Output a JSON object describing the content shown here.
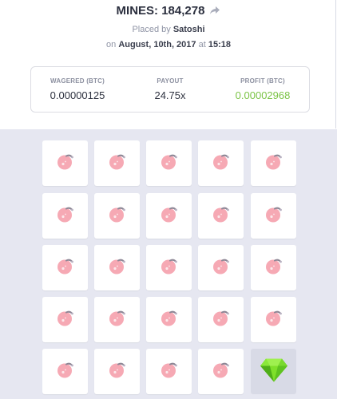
{
  "header": {
    "title": "MINES: 184,278",
    "placed_prefix": "Placed by ",
    "player": "Satoshi",
    "date_prefix": "on ",
    "date": "August, 10th, 2017",
    "time_prefix": " at ",
    "time": "15:18"
  },
  "stats": {
    "wagered_label": "WAGERED (BTC)",
    "wagered_value": "0.00000125",
    "payout_label": "PAYOUT",
    "payout_value": "24.75x",
    "profit_label": "PROFIT (BTC)",
    "profit_value": "0.00002968"
  },
  "colors": {
    "profit": "#7cc447",
    "mine": "#f6a9b4",
    "gem": "#7fe02a",
    "board_bg": "#e6e7f1"
  },
  "board": {
    "rows": 5,
    "cols": 5,
    "tiles": [
      "mine",
      "mine",
      "mine",
      "mine",
      "mine",
      "mine",
      "mine",
      "mine",
      "mine",
      "mine",
      "mine",
      "mine",
      "mine",
      "mine",
      "mine",
      "mine",
      "mine",
      "mine",
      "mine",
      "mine",
      "mine",
      "mine",
      "mine",
      "mine",
      "gem"
    ],
    "revealed_index": 24
  }
}
